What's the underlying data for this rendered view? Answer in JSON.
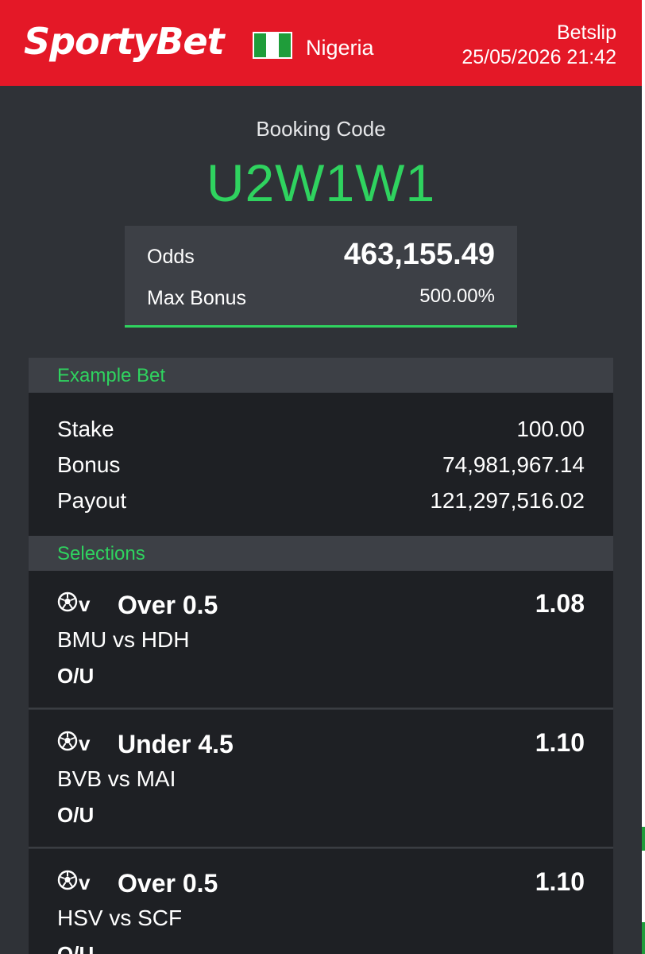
{
  "header": {
    "brand": "SportyBet",
    "country": "Nigeria",
    "title": "Betslip",
    "datetime": "25/05/2026 21:42",
    "brand_color": "#e41827",
    "flag_icon": "nigeria-flag-icon"
  },
  "booking": {
    "label": "Booking Code",
    "code": "U2W1W1",
    "accent_color": "#2fd35f"
  },
  "summary": {
    "odds_label": "Odds",
    "odds_value": "463,155.49",
    "max_bonus_label": "Max Bonus",
    "max_bonus_value": "500.00%"
  },
  "example_bet": {
    "title": "Example Bet",
    "rows": [
      {
        "label": "Stake",
        "value": "100.00"
      },
      {
        "label": "Bonus",
        "value": "74,981,967.14"
      },
      {
        "label": "Payout",
        "value": "121,297,516.02"
      }
    ]
  },
  "selections": {
    "title": "Selections",
    "items": [
      {
        "icon": "soccer-ball-icon",
        "virtual_mark": "v",
        "pick": "Over 0.5",
        "odds": "1.08",
        "match": "BMU vs HDH",
        "market": "O/U"
      },
      {
        "icon": "soccer-ball-icon",
        "virtual_mark": "v",
        "pick": "Under 4.5",
        "odds": "1.10",
        "match": "BVB vs MAI",
        "market": "O/U"
      },
      {
        "icon": "soccer-ball-icon",
        "virtual_mark": "v",
        "pick": "Over 0.5",
        "odds": "1.10",
        "match": "HSV vs SCF",
        "market": "O/U"
      }
    ]
  }
}
